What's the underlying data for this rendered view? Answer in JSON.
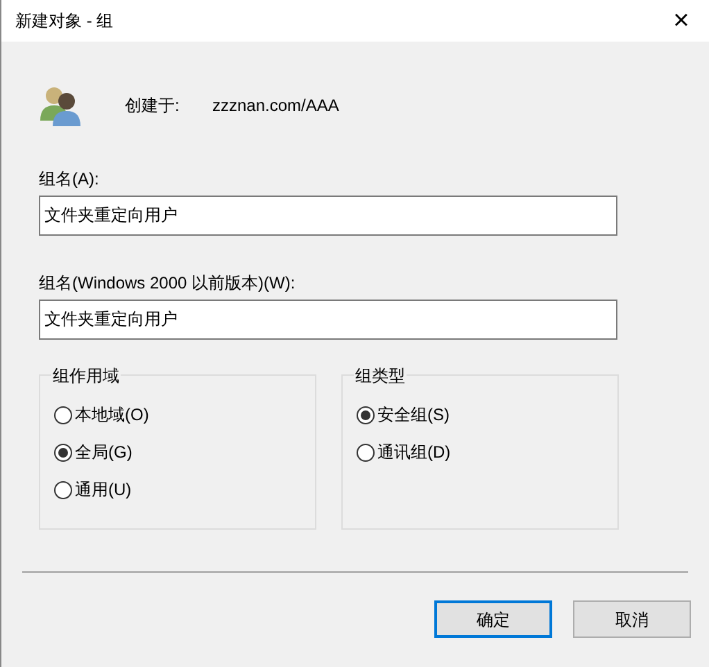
{
  "window": {
    "title": "新建对象 - 组",
    "close": "×"
  },
  "created_in": {
    "label": "创建于:",
    "value": "zzznan.com/AAA"
  },
  "group_name": {
    "label": "组名(A):",
    "value": "文件夹重定向用户"
  },
  "group_name_pre2000": {
    "label": "组名(Windows 2000 以前版本)(W):",
    "value": "文件夹重定向用户"
  },
  "groups": [
    {
      "title": "组作用域",
      "options": [
        {
          "label": "本地域(O)",
          "selected": false
        },
        {
          "label": "全局(G)",
          "selected": true
        },
        {
          "label": "通用(U)",
          "selected": false
        }
      ]
    },
    {
      "title": "组类型",
      "options": [
        {
          "label": "安全组(S)",
          "selected": true
        },
        {
          "label": "通讯组(D)",
          "selected": false
        }
      ]
    }
  ],
  "buttons": [
    {
      "label": "确定",
      "default": true
    },
    {
      "label": "取消",
      "default": false
    }
  ]
}
